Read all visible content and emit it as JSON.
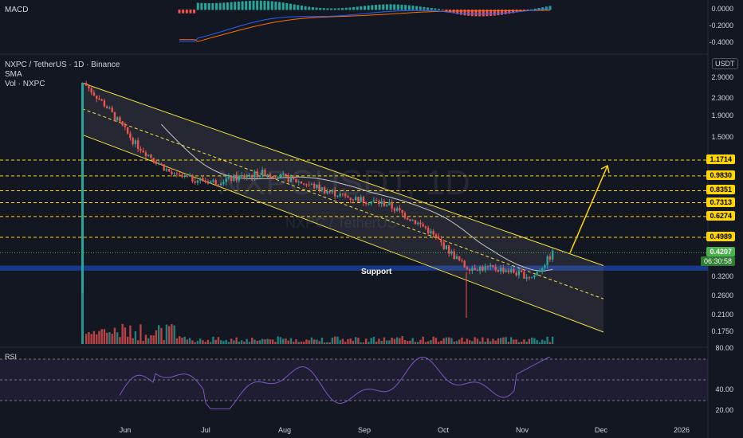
{
  "watermark": {
    "symbol": "NXPCUSDT, 1D",
    "name": "NXPC / TetherUS"
  },
  "macd": {
    "label": "MACD",
    "ticks": [
      "0.0000",
      "-0.2000",
      "-0.4000"
    ]
  },
  "main": {
    "title": "NXPC / TetherUS · 1D · Binance",
    "indicators": [
      "SMA",
      "Vol · NXPC"
    ],
    "unit": "USDT",
    "support_label": "Support",
    "price_ticks": [
      "2.9000",
      "2.3000",
      "1.9000",
      "1.5000",
      "0.3200",
      "0.2600",
      "0.2100",
      "0.1750"
    ],
    "levels": [
      "1.1714",
      "0.9830",
      "0.8351",
      "0.7313",
      "0.6274",
      "0.4989"
    ],
    "last_price": "0.4207",
    "countdown": "06:30:58",
    "colors": {
      "up": "#26a69a",
      "down": "#ef5350",
      "channel": "#f0e040",
      "support": "#1a3f9a",
      "level": "#ffd600",
      "last": "#4caf50",
      "sma": "#c8c8c8",
      "macd": "#2962ff",
      "signal": "#ff6d00",
      "rsi": "#7e57c2"
    }
  },
  "rsi": {
    "label": "RSI",
    "ticks": [
      "80.00",
      "40.00",
      "20.00"
    ]
  },
  "xaxis": [
    "Jun",
    "Jul",
    "Aug",
    "Sep",
    "Oct",
    "Nov",
    "Dec",
    "2026"
  ],
  "chart_data": {
    "type": "candlestick",
    "interval": "1D",
    "scale": "log",
    "ohlc_close_approx": [
      {
        "date": "2025-05-16",
        "close": 2.75
      },
      {
        "date": "2025-05-25",
        "close": 2.1
      },
      {
        "date": "2025-06-05",
        "close": 1.4
      },
      {
        "date": "2025-06-20",
        "close": 0.98
      },
      {
        "date": "2025-07-05",
        "close": 0.92
      },
      {
        "date": "2025-07-25",
        "close": 1.02
      },
      {
        "date": "2025-08-10",
        "close": 0.9
      },
      {
        "date": "2025-08-25",
        "close": 0.78
      },
      {
        "date": "2025-09-10",
        "close": 0.72
      },
      {
        "date": "2025-09-25",
        "close": 0.55
      },
      {
        "date": "2025-10-10",
        "close": 0.36
      },
      {
        "date": "2025-10-25",
        "close": 0.35
      },
      {
        "date": "2025-11-05",
        "close": 0.32
      },
      {
        "date": "2025-11-13",
        "close": 0.4207
      }
    ],
    "levels": [
      1.1714,
      0.983,
      0.8351,
      0.7313,
      0.6274,
      0.4989
    ],
    "support_zone": [
      0.345,
      0.365
    ],
    "projection_target": 1.1714
  }
}
